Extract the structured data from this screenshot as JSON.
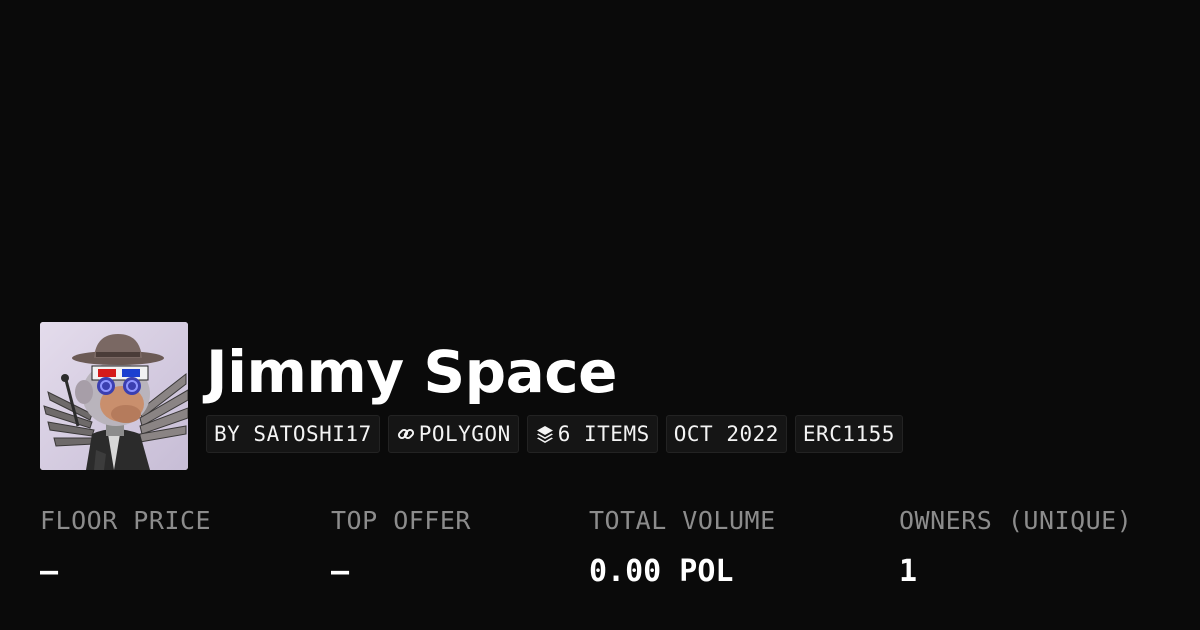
{
  "collection": {
    "name": "Jimmy Space",
    "avatar_icon": "ape-avatar-image"
  },
  "badges": {
    "creator": "BY SATOSHI17",
    "chain": "POLYGON",
    "chain_icon": "link-icon",
    "items": "6 ITEMS",
    "items_icon": "layers-icon",
    "date": "OCT 2022",
    "standard": "ERC1155"
  },
  "stats": {
    "floor_price": {
      "label": "FLOOR PRICE",
      "value": "–"
    },
    "top_offer": {
      "label": "TOP OFFER",
      "value": "–"
    },
    "total_volume": {
      "label": "TOTAL VOLUME",
      "value": "0.00 POL"
    },
    "owners": {
      "label": "OWNERS (UNIQUE)",
      "value": "1"
    }
  },
  "colors": {
    "background": "#0a0a0a",
    "badge_background": "#151515",
    "label_gray": "#8c8c8c"
  }
}
